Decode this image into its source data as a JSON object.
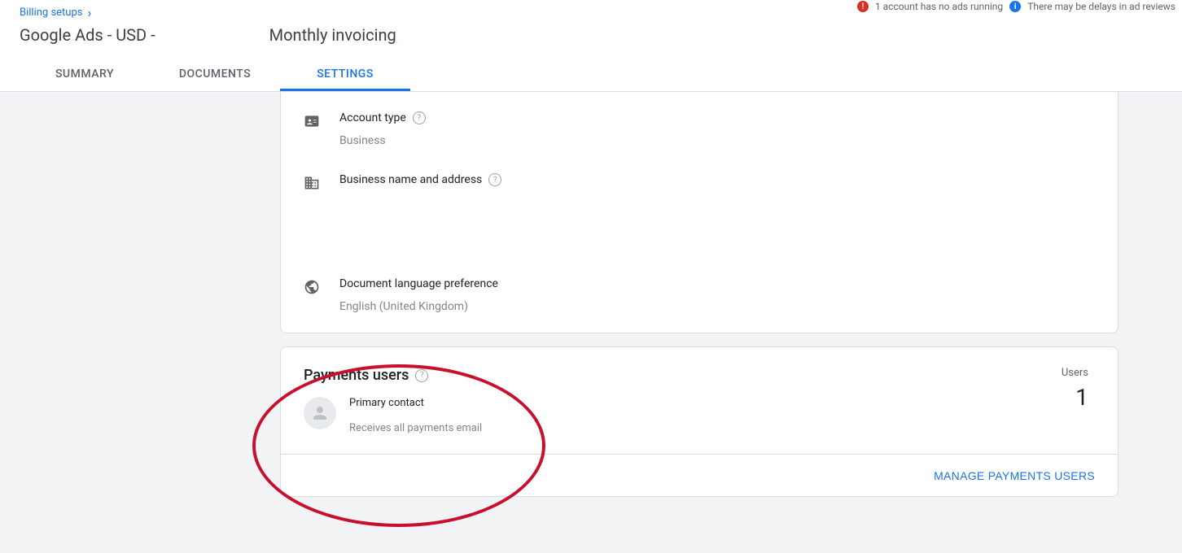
{
  "breadcrumb": {
    "label": "Billing setups"
  },
  "header": {
    "title": "Google Ads - USD -",
    "section": "Monthly invoicing"
  },
  "tabs": [
    {
      "label": "SUMMARY",
      "active": false
    },
    {
      "label": "DOCUMENTS",
      "active": false
    },
    {
      "label": "SETTINGS",
      "active": true
    }
  ],
  "notifications": {
    "n1": "1 account has no ads running",
    "n2": "There may be delays in ad reviews"
  },
  "settings": {
    "account_type": {
      "label": "Account type",
      "value": "Business"
    },
    "business_address": {
      "label": "Business name and address"
    },
    "language": {
      "label": "Document language preference",
      "value": "English (United Kingdom)"
    }
  },
  "payments": {
    "title": "Payments users",
    "contact_label": "Primary contact",
    "contact_desc": "Receives all payments email",
    "users_label": "Users",
    "users_count": "1",
    "manage_button": "MANAGE PAYMENTS USERS"
  }
}
